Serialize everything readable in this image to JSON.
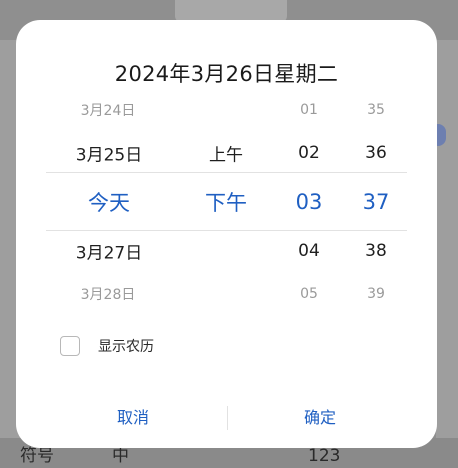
{
  "background": {
    "keyboard_keys": [
      "符号",
      "中",
      "123"
    ]
  },
  "dialog": {
    "title": "2024年3月26日星期二",
    "date_column": [
      "3月24日",
      "3月25日",
      "今天",
      "3月27日",
      "3月28日"
    ],
    "ampm_column": [
      "",
      "上午",
      "下午",
      "",
      ""
    ],
    "hour_column": [
      "01",
      "02",
      "03",
      "04",
      "05"
    ],
    "minute_column": [
      "35",
      "36",
      "37",
      "38",
      "39"
    ],
    "selected_index": 2,
    "show_lunar_label": "显示农历",
    "show_lunar_checked": false,
    "cancel_label": "取消",
    "confirm_label": "确定"
  },
  "colors": {
    "accent": "#1f5fc2",
    "dialog_bg": "#ffffff",
    "scrim": "#8f8f8f"
  }
}
